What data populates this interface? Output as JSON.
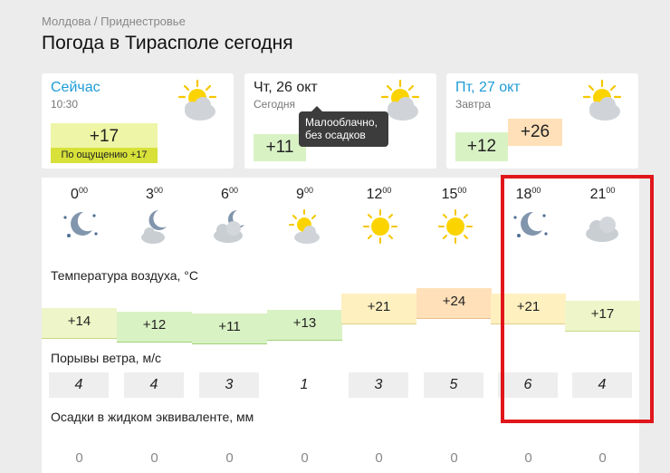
{
  "breadcrumb": {
    "country": "Молдова",
    "sep": " / ",
    "region": "Приднестровье"
  },
  "page_title": "Погода в Тирасполе сегодня",
  "now_card": {
    "title": "Сейчас",
    "time": "10:30",
    "temp": "+17",
    "feels_like": "По ощущению +17",
    "icon": "sun-cloud-icon"
  },
  "today_card": {
    "title": "Чт, 26 окт",
    "sub": "Сегодня",
    "temp": "+11",
    "icon": "sun-cloud-icon"
  },
  "tomorrow_card": {
    "title": "Пт, 27 окт",
    "sub": "Завтра",
    "temp_min": "+12",
    "temp_max": "+26",
    "icon": "sun-cloud-icon"
  },
  "tooltip": {
    "line1": "Малооблачно,",
    "line2": "без осадков"
  },
  "hourly": {
    "temp_label": "Температура воздуха, °С",
    "wind_label": "Порывы ветра, м/с",
    "precip_label": "Осадки в жидком эквиваленте, мм",
    "hours": [
      {
        "h": "0",
        "m": "00",
        "icon": "night-clear-icon",
        "temp": "+14",
        "wind": "4",
        "precip": "0"
      },
      {
        "h": "3",
        "m": "00",
        "icon": "night-cloud-icon",
        "temp": "+12",
        "wind": "4",
        "precip": "0"
      },
      {
        "h": "6",
        "m": "00",
        "icon": "night-cloudy-icon",
        "temp": "+11",
        "wind": "3",
        "precip": "0"
      },
      {
        "h": "9",
        "m": "00",
        "icon": "sun-cloud-icon",
        "temp": "+13",
        "wind": "1",
        "precip": "0"
      },
      {
        "h": "12",
        "m": "00",
        "icon": "sun-icon",
        "temp": "+21",
        "wind": "3",
        "precip": "0"
      },
      {
        "h": "15",
        "m": "00",
        "icon": "sun-icon",
        "temp": "+24",
        "wind": "5",
        "precip": "0"
      },
      {
        "h": "18",
        "m": "00",
        "icon": "night-clear-icon",
        "temp": "+21",
        "wind": "6",
        "precip": "0"
      },
      {
        "h": "21",
        "m": "00",
        "icon": "cloudy-icon",
        "temp": "+17",
        "wind": "4",
        "precip": "0"
      }
    ]
  },
  "colors": {
    "accent": "#1e9bd7",
    "highlight": "#e0161b",
    "warm": "#fff0c0",
    "hot": "#ffe0b8",
    "mild": "#eef5c8",
    "cool": "#d9f2c4"
  }
}
